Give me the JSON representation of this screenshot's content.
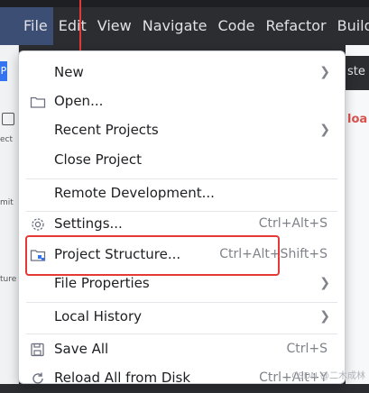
{
  "menubar": {
    "items": [
      {
        "label": "File",
        "mnemonic": "F"
      },
      {
        "label": "Edit",
        "mnemonic": "E"
      },
      {
        "label": "View",
        "mnemonic": "V"
      },
      {
        "label": "Navigate",
        "mnemonic": "N"
      },
      {
        "label": "Code",
        "mnemonic": "C"
      },
      {
        "label": "Refactor",
        "mnemonic": "R"
      },
      {
        "label": "Build",
        "mnemonic": "B"
      }
    ]
  },
  "left_strip": {
    "badge": "P",
    "labels": [
      "ect",
      "mit",
      "ture"
    ]
  },
  "right_peek": {
    "dark_text": "ste",
    "red_text": "loa"
  },
  "file_menu": {
    "new": "New",
    "open": "Open...",
    "recent_projects": "Recent Projects",
    "close_project": "Close Project",
    "remote_development": "Remote Development...",
    "settings": "Settings...",
    "settings_shortcut": "Ctrl+Alt+S",
    "project_structure": "Project Structure...",
    "project_structure_shortcut": "Ctrl+Alt+Shift+S",
    "file_properties": "File Properties",
    "local_history": "Local History",
    "save_all": "Save All",
    "save_all_shortcut": "Ctrl+S",
    "reload_all": "Reload All from Disk",
    "reload_all_shortcut": "Ctrl+Alt+Y"
  },
  "watermark": "CSDN @二木成林",
  "colors": {
    "menubar_bg": "#2b2d30",
    "active_menu_bg": "#3d4e74",
    "annotation_red": "#e53935",
    "menu_bg": "#ffffff"
  }
}
